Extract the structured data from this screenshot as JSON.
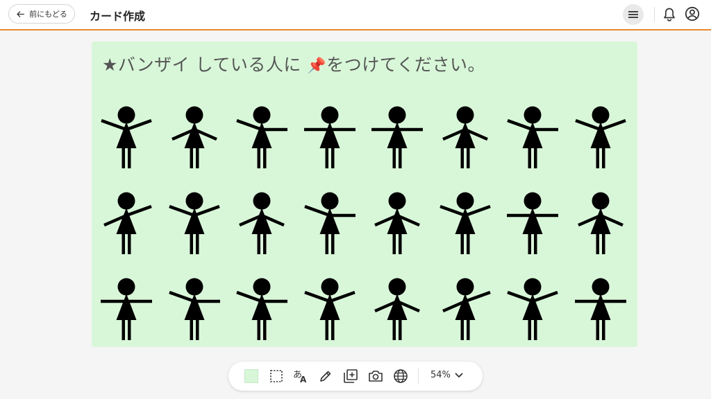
{
  "header": {
    "back_label": "前にもどる",
    "title": "カード作成"
  },
  "canvas": {
    "background": "#d8f7d8",
    "instruction_before": "★バンザイ している人に ",
    "instruction_pin": "📌",
    "instruction_after": "をつけてください。",
    "figure_pose_legend": "arm values: U=raised up, H=horizontal, D=lowered down",
    "figures": [
      {
        "left": "U",
        "right": "U"
      },
      {
        "left": "D",
        "right": "D"
      },
      {
        "left": "U",
        "right": "H"
      },
      {
        "left": "H",
        "right": "H"
      },
      {
        "left": "H",
        "right": "H"
      },
      {
        "left": "D",
        "right": "D"
      },
      {
        "left": "U",
        "right": "H"
      },
      {
        "left": "U",
        "right": "U"
      },
      {
        "left": "D",
        "right": "U"
      },
      {
        "left": "U",
        "right": "U"
      },
      {
        "left": "D",
        "right": "D"
      },
      {
        "left": "U",
        "right": "H"
      },
      {
        "left": "D",
        "right": "D"
      },
      {
        "left": "U",
        "right": "U"
      },
      {
        "left": "H",
        "right": "H"
      },
      {
        "left": "D",
        "right": "D"
      },
      {
        "left": "H",
        "right": "H"
      },
      {
        "left": "U",
        "right": "H"
      },
      {
        "left": "U",
        "right": "H"
      },
      {
        "left": "U",
        "right": "U"
      },
      {
        "left": "D",
        "right": "D"
      },
      {
        "left": "D",
        "right": "U"
      },
      {
        "left": "U",
        "right": "U"
      },
      {
        "left": "H",
        "right": "H"
      }
    ]
  },
  "toolbar": {
    "icons": [
      "color-swatch-icon",
      "select-area-icon",
      "translate-icon",
      "pencil-icon",
      "add-card-icon",
      "camera-icon",
      "globe-icon"
    ],
    "zoom_label": "54%"
  }
}
